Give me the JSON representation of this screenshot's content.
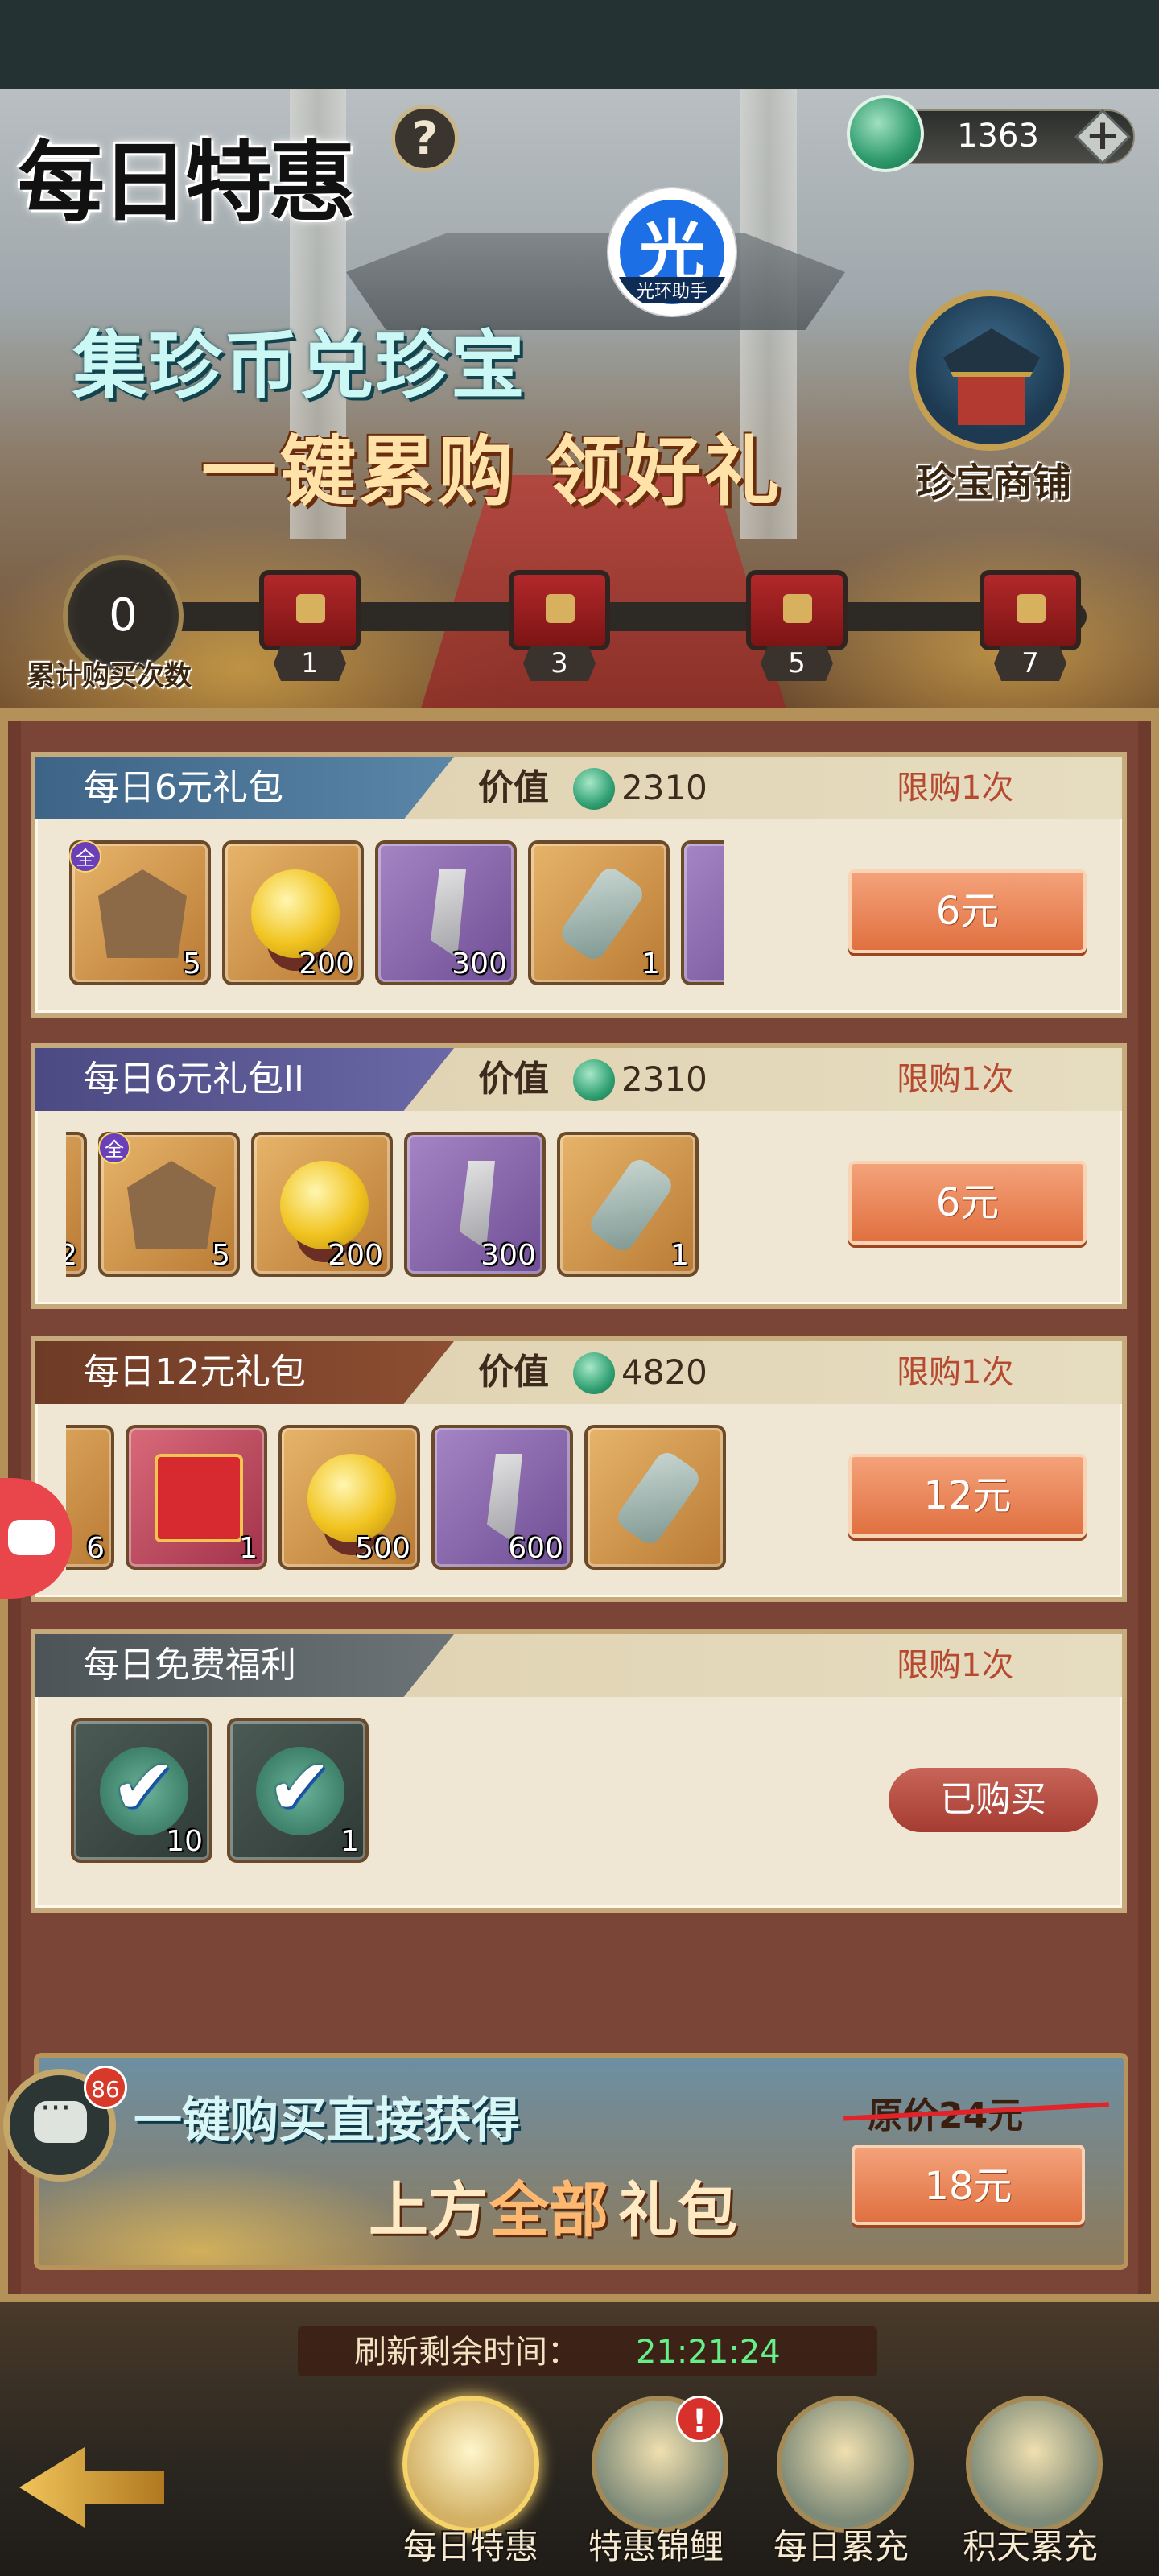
{
  "header": {
    "title": "每日特惠",
    "help_icon": "?",
    "currency": {
      "icon": "jade-coin-icon",
      "amount": "1363",
      "add_icon": "+"
    },
    "helper_badge": {
      "glyph": "光",
      "caption": "光环助手"
    }
  },
  "banner": {
    "slogan_line1": "集珍币兑珍宝",
    "slogan_line2": "一键累购 领好礼",
    "shop_label": "珍宝商铺",
    "progress": {
      "count": "0",
      "label": "累计购买次数",
      "milestones": [
        "1",
        "3",
        "5",
        "7"
      ]
    }
  },
  "packs": [
    {
      "name": "每日6元礼包",
      "value_label": "价值",
      "value": "2310",
      "limit": "限购1次",
      "button": "6元",
      "items": [
        {
          "icon": "armor-crest-icon",
          "qty": "5",
          "tag": "全"
        },
        {
          "icon": "golden-orb-icon",
          "qty": "200"
        },
        {
          "icon": "blade-icon",
          "qty": "300"
        },
        {
          "icon": "scroll-icon",
          "qty": "1"
        }
      ]
    },
    {
      "name": "每日6元礼包II",
      "value_label": "价值",
      "value": "2310",
      "limit": "限购1次",
      "button": "6元",
      "items": [
        {
          "icon": "partial-item-icon",
          "qty": "2"
        },
        {
          "icon": "armor-crest-icon",
          "qty": "5",
          "tag": "全"
        },
        {
          "icon": "golden-orb-icon",
          "qty": "200"
        },
        {
          "icon": "blade-icon",
          "qty": "300"
        },
        {
          "icon": "scroll-icon",
          "qty": "1"
        }
      ]
    },
    {
      "name": "每日12元礼包",
      "value_label": "价值",
      "value": "4820",
      "limit": "限购1次",
      "button": "12元",
      "items": [
        {
          "icon": "partial-item-icon",
          "qty": "6"
        },
        {
          "icon": "red-envelope-icon",
          "qty": "1"
        },
        {
          "icon": "golden-orb-icon",
          "qty": "500"
        },
        {
          "icon": "blade-icon",
          "qty": "600"
        },
        {
          "icon": "scroll-icon",
          "qty": ""
        }
      ]
    },
    {
      "name": "每日免费福利",
      "limit": "限购1次",
      "button": "已购买",
      "items": [
        {
          "icon": "jade-claimed-icon",
          "qty": "10"
        },
        {
          "icon": "coin-claimed-icon",
          "qty": "1"
        }
      ]
    }
  ],
  "combo": {
    "line1": "一键购买直接获得",
    "line2_a": "上方",
    "line2_b": "全部",
    "line2_c": "礼包",
    "original_price": "原价24元",
    "button": "18元"
  },
  "chat": {
    "badge": "86"
  },
  "footer": {
    "refresh_label": "刷新剩余时间：",
    "refresh_time": "21:21:24",
    "nav": [
      "每日特惠",
      "特惠锦鲤",
      "每日累充",
      "积天累充"
    ],
    "nav_alert": "!"
  }
}
